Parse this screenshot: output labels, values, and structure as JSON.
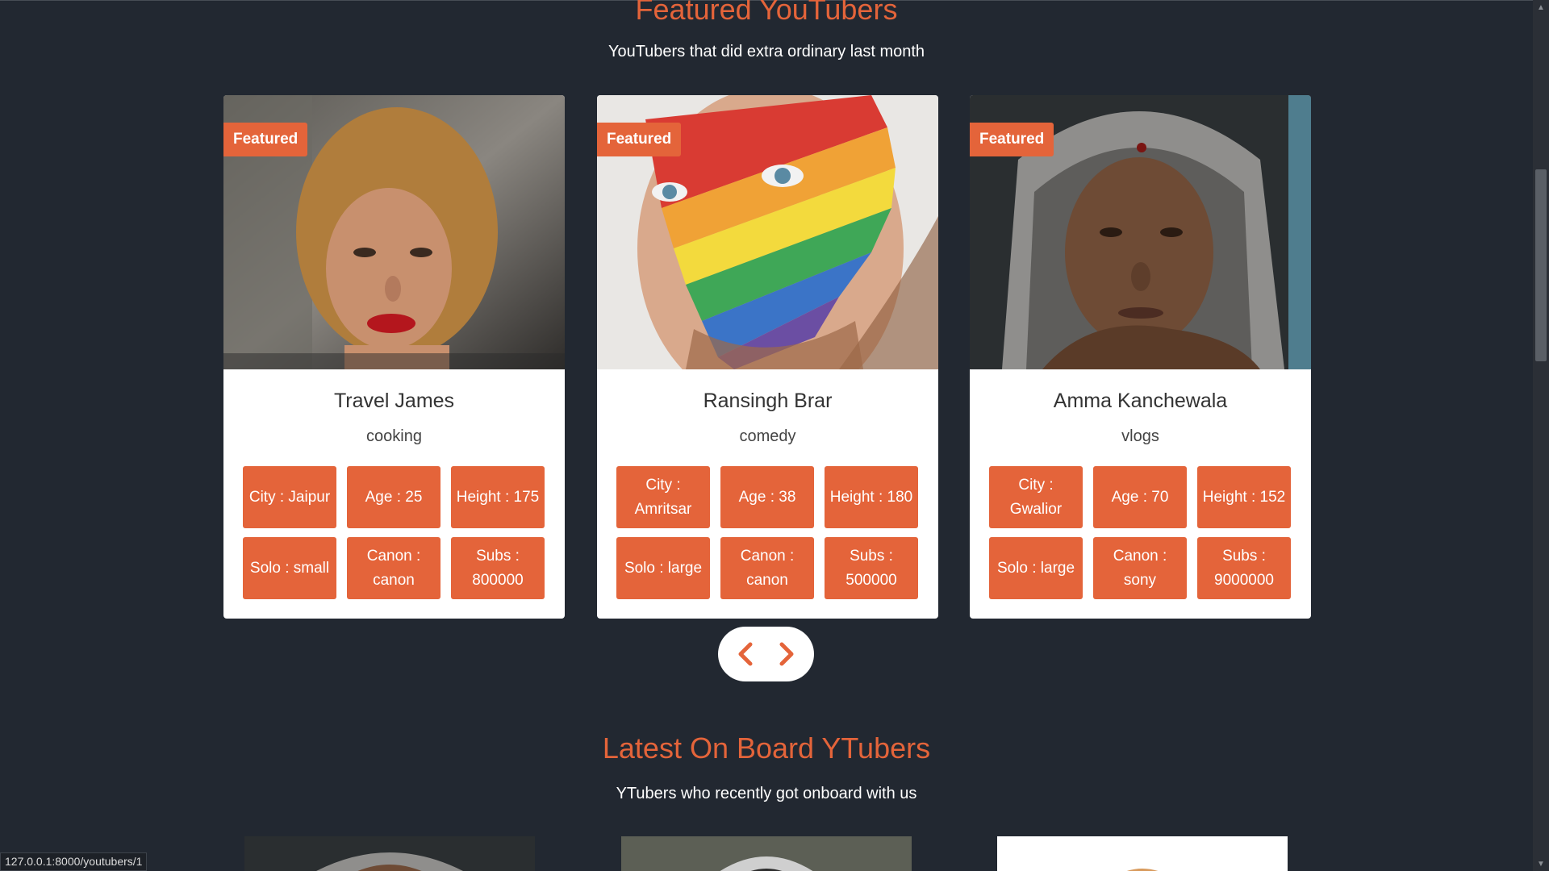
{
  "featured": {
    "title": "Featured YouTubers",
    "subtitle": "YouTubers that did extra ordinary last month",
    "badge": "Featured",
    "cards": [
      {
        "name": "Travel James",
        "category": "cooking",
        "stats": [
          "City : Jaipur",
          "Age : 25",
          "Height : 175",
          "Solo : small",
          "Canon : canon",
          "Subs : 800000"
        ]
      },
      {
        "name": "Ransingh Brar",
        "category": "comedy",
        "stats": [
          "City : Amritsar",
          "Age : 38",
          "Height : 180",
          "Solo : large",
          "Canon : canon",
          "Subs : 500000"
        ]
      },
      {
        "name": "Amma Kanchewala",
        "category": "vlogs",
        "stats": [
          "City : Gwalior",
          "Age : 70",
          "Height : 152",
          "Solo : large",
          "Canon : sony",
          "Subs : 9000000"
        ]
      }
    ]
  },
  "latest": {
    "title": "Latest On Board YTubers",
    "subtitle": "YTubers who recently got onboard with us"
  },
  "status_url": "127.0.0.1:8000/youtubers/1",
  "colors": {
    "background": "#222831",
    "accent": "#e4643a",
    "card": "#ffffff"
  },
  "icons": {
    "prev": "chevron-left-icon",
    "next": "chevron-right-icon"
  }
}
